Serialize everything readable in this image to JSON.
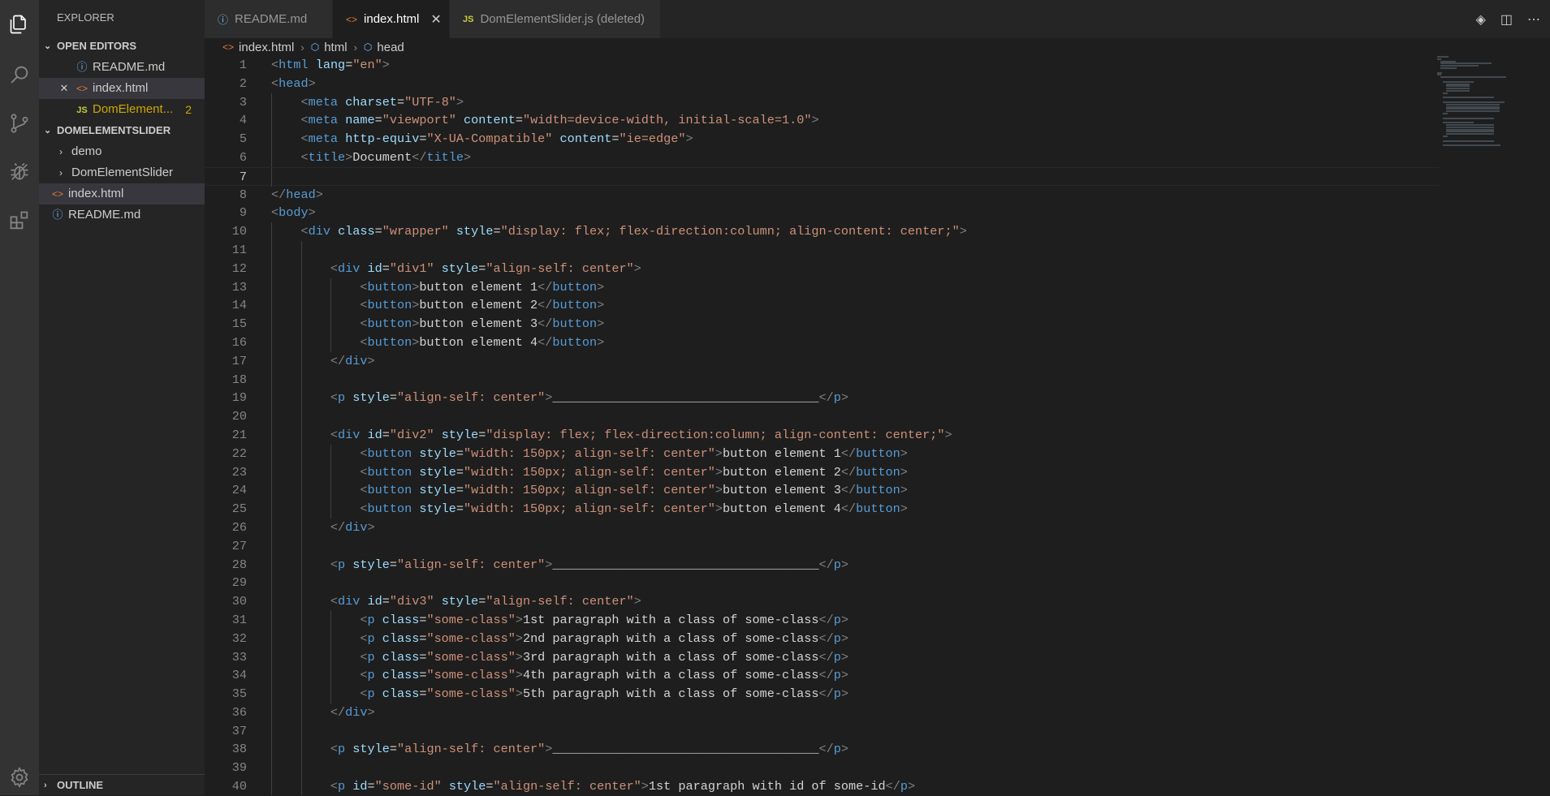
{
  "activity_bar": {
    "items": [
      {
        "name": "explorer-icon"
      },
      {
        "name": "search-icon"
      },
      {
        "name": "source-control-icon"
      },
      {
        "name": "run-debug-icon"
      },
      {
        "name": "extensions-icon"
      }
    ],
    "bottom": {
      "name": "settings-gear-icon"
    }
  },
  "sidebar": {
    "title": "EXPLORER",
    "open_editors_label": "OPEN EDITORS",
    "open_editors": [
      {
        "label": "README.md",
        "icon": "info-icon"
      },
      {
        "label": "index.html",
        "icon": "html-file-icon"
      },
      {
        "label": "DomElement...",
        "icon": "js-file-icon",
        "badge": "2"
      }
    ],
    "folder_label": "DOMELEMENTSLIDER",
    "folder_items": [
      {
        "label": "demo",
        "type": "folder"
      },
      {
        "label": "DomElementSlider",
        "type": "folder"
      },
      {
        "label": "index.html",
        "type": "html"
      },
      {
        "label": "README.md",
        "type": "info"
      }
    ],
    "outline_label": "OUTLINE"
  },
  "tabs": [
    {
      "label": "README.md",
      "icon": "info-icon"
    },
    {
      "label": "index.html",
      "icon": "html-file-icon",
      "active": true
    },
    {
      "label": "DomElementSlider.js (deleted)",
      "icon": "js-file-icon"
    }
  ],
  "breadcrumb": [
    "index.html",
    "html",
    "head"
  ],
  "editor": {
    "current_line": 7,
    "lines": [
      "<html lang=\"en\">",
      "<head>",
      "    <meta charset=\"UTF-8\">",
      "    <meta name=\"viewport\" content=\"width=device-width, initial-scale=1.0\">",
      "    <meta http-equiv=\"X-UA-Compatible\" content=\"ie=edge\">",
      "    <title>Document</title>",
      "",
      "</head>",
      "<body>",
      "    <div class=\"wrapper\" style=\"display: flex; flex-direction:column; align-content: center;\">",
      "",
      "        <div id=\"div1\" style=\"align-self: center\">",
      "            <button>button element 1</button>",
      "            <button>button element 2</button>",
      "            <button>button element 3</button>",
      "            <button>button element 4</button>",
      "        </div>",
      "",
      "        <p style=\"align-self: center\">____________________________________</p>",
      "",
      "        <div id=\"div2\" style=\"display: flex; flex-direction:column; align-content: center;\">",
      "            <button style=\"width: 150px; align-self: center\">button element 1</button>",
      "            <button style=\"width: 150px; align-self: center\">button element 2</button>",
      "            <button style=\"width: 150px; align-self: center\">button element 3</button>",
      "            <button style=\"width: 150px; align-self: center\">button element 4</button>",
      "        </div>",
      "",
      "        <p style=\"align-self: center\">____________________________________</p>",
      "",
      "        <div id=\"div3\" style=\"align-self: center\">",
      "            <p class=\"some-class\">1st paragraph with a class of some-class</p>",
      "            <p class=\"some-class\">2nd paragraph with a class of some-class</p>",
      "            <p class=\"some-class\">3rd paragraph with a class of some-class</p>",
      "            <p class=\"some-class\">4th paragraph with a class of some-class</p>",
      "            <p class=\"some-class\">5th paragraph with a class of some-class</p>",
      "        </div>",
      "",
      "        <p style=\"align-self: center\">____________________________________</p>",
      "",
      "        <p id=\"some-id\" style=\"align-self: center\">1st paragraph with id of some-id</p>"
    ]
  },
  "colors": {
    "tag": "#569cd6",
    "bracket": "#808080",
    "attribute": "#9cdcfe",
    "string": "#ce9178",
    "text": "#d4d4d4",
    "line_number": "#858585",
    "html_icon": "#e37933",
    "js_icon": "#cbcb41",
    "info_icon": "#75beff",
    "badge": "#cca700"
  }
}
